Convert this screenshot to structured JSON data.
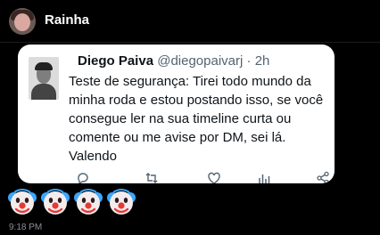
{
  "chat": {
    "contact_name": "Rainha"
  },
  "tweet": {
    "display_name": "Diego Paiva",
    "handle": "@diegopaivarj",
    "separator": "·",
    "age": "2h",
    "text": "Teste de segurança: Tirei todo mundo da minha roda e estou postando isso, se você consegue ler na sua timeline curta ou comente ou me avise por DM, sei lá. Valendo"
  },
  "tweet_actions": [
    "reply-icon",
    "retweet-icon",
    "like-icon",
    "views-icon",
    "share-icon"
  ],
  "reaction": {
    "emoji": "🤡",
    "count": 4
  },
  "message": {
    "time": "9:18 PM"
  },
  "colors": {
    "background": "#000000",
    "card": "#ffffff",
    "text": "#0f1419",
    "muted": "#536471"
  }
}
